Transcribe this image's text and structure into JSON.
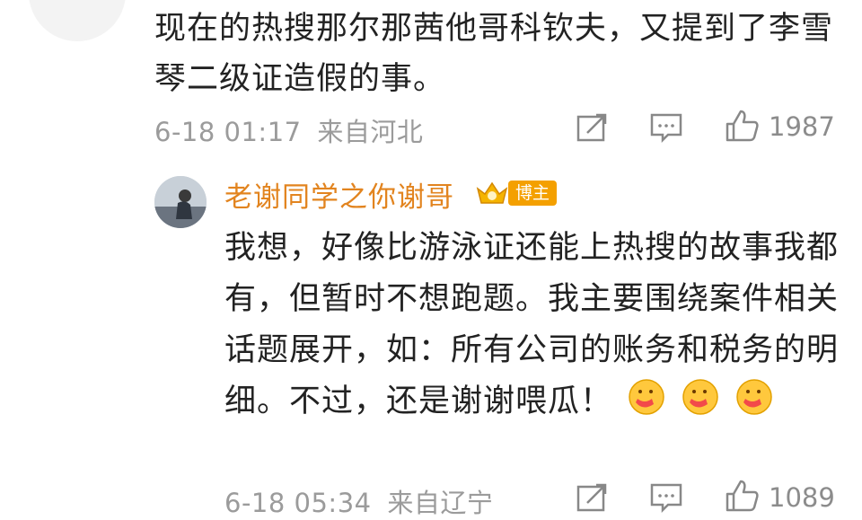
{
  "comment": {
    "text": "现在的热搜那尔那茜他哥科钦夫，又提到了李雪琴二级证造假的事。",
    "time": "6-18 01:17",
    "location": "来自河北",
    "likes": "1987",
    "icons": {
      "share": "share-icon",
      "comment": "comment-icon",
      "like": "thumbs-up-icon"
    }
  },
  "reply": {
    "author": "老谢同学之你谢哥",
    "badge": "博主",
    "text": "我想，好像比游泳证还能上热搜的故事我都有，但暂时不想跑题。我主要围绕案件相关话题展开，如：所有公司的账务和税务的明细。不过，还是谢谢喂瓜！",
    "time": "6-18 05:34",
    "location": "来自辽宁",
    "likes": "1089",
    "emoji_count": 3
  }
}
